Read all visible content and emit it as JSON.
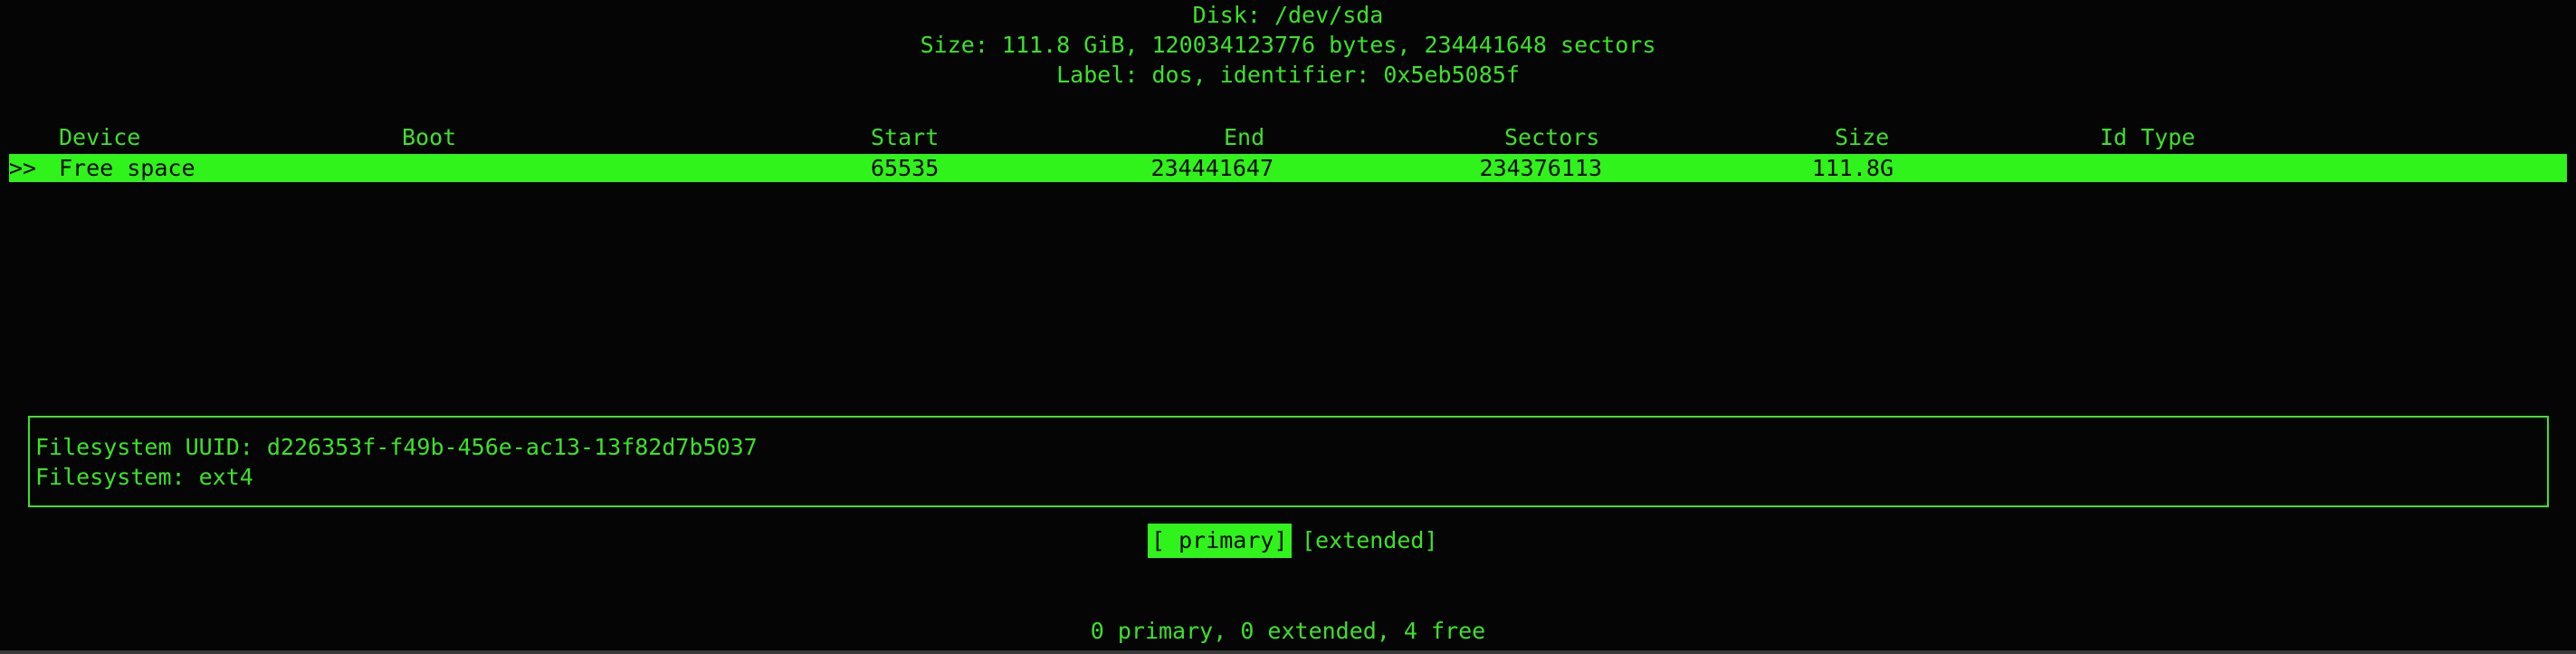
{
  "disk": {
    "title": "Disk: /dev/sda",
    "size_line": "Size: 111.8 GiB, 120034123776 bytes, 234441648 sectors",
    "label_line": "Label: dos, identifier: 0x5eb5085f"
  },
  "table": {
    "columns": {
      "device": "Device",
      "boot": "Boot",
      "start": "Start",
      "end": "End",
      "sectors": "Sectors",
      "size": "Size",
      "id_type": "Id Type"
    },
    "rows": [
      {
        "marker": ">>",
        "device": "Free space",
        "boot": "",
        "start": "65535",
        "end": "234441647",
        "sectors": "234376113",
        "size": "111.8G",
        "id_type": ""
      }
    ]
  },
  "info": {
    "uuid_line": "Filesystem UUID: d226353f-f49b-456e-ac13-13f82d7b5037",
    "fs_line": "     Filesystem: ext4"
  },
  "menu": {
    "primary": "[ primary]",
    "extended": "[extended]"
  },
  "status": "0 primary, 0 extended, 4 free",
  "colors": {
    "foreground": "#3de22a",
    "highlight": "#2ff31a",
    "background": "#050505"
  }
}
